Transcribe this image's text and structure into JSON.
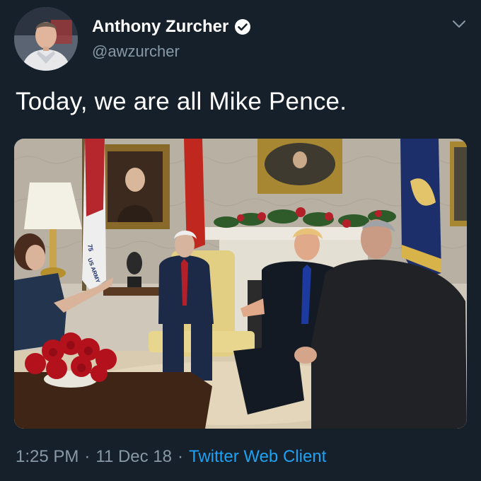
{
  "tweet": {
    "author": {
      "display_name": "Anthony Zurcher",
      "handle": "@awzurcher",
      "verified": true,
      "verified_icon": "verified-badge-icon",
      "avatar": "profile-photo"
    },
    "menu_icon": "chevron-down-icon",
    "text": "Today, we are all Mike Pence.",
    "media": {
      "type": "photo",
      "flag_text": "US ARMY",
      "flag_number": "75"
    },
    "time": "1:25 PM",
    "separator": "·",
    "date": "11 Dec 18",
    "source": "Twitter Web Client"
  },
  "colors": {
    "background": "#15202b",
    "primary_text": "#ffffff",
    "secondary_text": "#8899a6",
    "link": "#1da1f2"
  }
}
